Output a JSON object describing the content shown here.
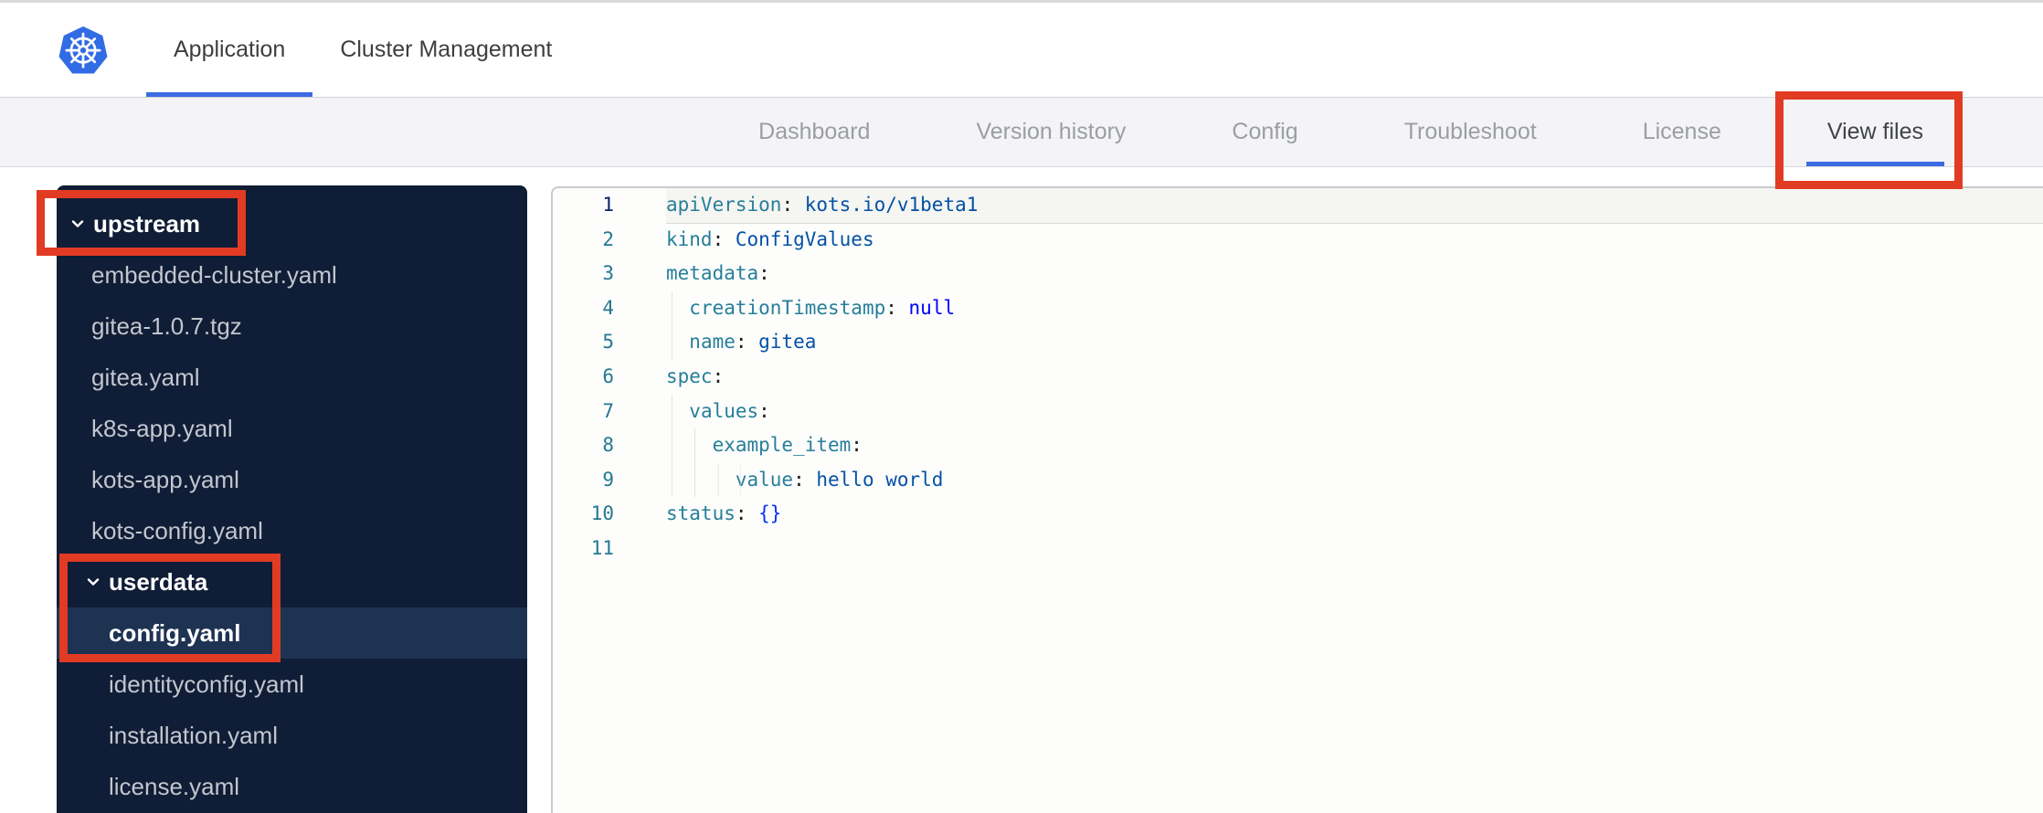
{
  "header": {
    "tabs": [
      {
        "label": "Application",
        "active": true
      },
      {
        "label": "Cluster Management",
        "active": false
      }
    ]
  },
  "nav": {
    "tabs": [
      {
        "label": "Dashboard",
        "active": false
      },
      {
        "label": "Version history",
        "active": false
      },
      {
        "label": "Config",
        "active": false
      },
      {
        "label": "Troubleshoot",
        "active": false
      },
      {
        "label": "License",
        "active": false
      },
      {
        "label": "View files",
        "active": true
      }
    ]
  },
  "file_tree": {
    "items": [
      {
        "label": "upstream",
        "type": "folder",
        "level": 0,
        "expanded": true
      },
      {
        "label": "embedded-cluster.yaml",
        "type": "file",
        "level": 1
      },
      {
        "label": "gitea-1.0.7.tgz",
        "type": "file",
        "level": 1
      },
      {
        "label": "gitea.yaml",
        "type": "file",
        "level": 1
      },
      {
        "label": "k8s-app.yaml",
        "type": "file",
        "level": 1
      },
      {
        "label": "kots-app.yaml",
        "type": "file",
        "level": 1
      },
      {
        "label": "kots-config.yaml",
        "type": "file",
        "level": 1
      },
      {
        "label": "userdata",
        "type": "folder",
        "level": 1,
        "expanded": true
      },
      {
        "label": "config.yaml",
        "type": "file",
        "level": 2,
        "selected": true
      },
      {
        "label": "identityconfig.yaml",
        "type": "file",
        "level": 2
      },
      {
        "label": "installation.yaml",
        "type": "file",
        "level": 2
      },
      {
        "label": "license.yaml",
        "type": "file",
        "level": 2
      }
    ]
  },
  "editor": {
    "language": "yaml",
    "lines": [
      {
        "n": 1,
        "indent": 0,
        "active": true,
        "segments": [
          {
            "t": "apiVersion",
            "c": "key"
          },
          {
            "t": ": ",
            "c": "plain"
          },
          {
            "t": "kots.io/v1beta1",
            "c": "string"
          }
        ]
      },
      {
        "n": 2,
        "indent": 0,
        "segments": [
          {
            "t": "kind",
            "c": "key"
          },
          {
            "t": ": ",
            "c": "plain"
          },
          {
            "t": "ConfigValues",
            "c": "string"
          }
        ]
      },
      {
        "n": 3,
        "indent": 0,
        "segments": [
          {
            "t": "metadata",
            "c": "key"
          },
          {
            "t": ":",
            "c": "plain"
          }
        ]
      },
      {
        "n": 4,
        "indent": 1,
        "segments": [
          {
            "t": "  ",
            "c": "plain"
          },
          {
            "t": "creationTimestamp",
            "c": "key"
          },
          {
            "t": ": ",
            "c": "plain"
          },
          {
            "t": "null",
            "c": "keyword"
          }
        ]
      },
      {
        "n": 5,
        "indent": 1,
        "segments": [
          {
            "t": "  ",
            "c": "plain"
          },
          {
            "t": "name",
            "c": "key"
          },
          {
            "t": ": ",
            "c": "plain"
          },
          {
            "t": "gitea",
            "c": "string"
          }
        ]
      },
      {
        "n": 6,
        "indent": 0,
        "segments": [
          {
            "t": "spec",
            "c": "key"
          },
          {
            "t": ":",
            "c": "plain"
          }
        ]
      },
      {
        "n": 7,
        "indent": 1,
        "segments": [
          {
            "t": "  ",
            "c": "plain"
          },
          {
            "t": "values",
            "c": "key"
          },
          {
            "t": ":",
            "c": "plain"
          }
        ]
      },
      {
        "n": 8,
        "indent": 2,
        "segments": [
          {
            "t": "    ",
            "c": "plain"
          },
          {
            "t": "example_item",
            "c": "key"
          },
          {
            "t": ":",
            "c": "plain"
          }
        ]
      },
      {
        "n": 9,
        "indent": 3,
        "segments": [
          {
            "t": "      ",
            "c": "plain"
          },
          {
            "t": "value",
            "c": "key"
          },
          {
            "t": ": ",
            "c": "plain"
          },
          {
            "t": "hello world",
            "c": "string"
          }
        ]
      },
      {
        "n": 10,
        "indent": 0,
        "segments": [
          {
            "t": "status",
            "c": "key"
          },
          {
            "t": ": ",
            "c": "plain"
          },
          {
            "t": "{}",
            "c": "bracket"
          }
        ]
      },
      {
        "n": 11,
        "indent": 0,
        "segments": []
      }
    ]
  },
  "annotations": {
    "highlight_color": "#e23b24",
    "highlighted": [
      "upstream",
      "userdata + config.yaml",
      "View files"
    ]
  },
  "colors": {
    "accent_blue": "#3c6ce4",
    "kubernetes_blue": "#326ce5",
    "sidebar_bg": "#101d36",
    "sidebar_selected": "#1e3352",
    "yaml_key": "#267f99",
    "yaml_string": "#0451a5",
    "yaml_keyword": "#0000ff"
  }
}
